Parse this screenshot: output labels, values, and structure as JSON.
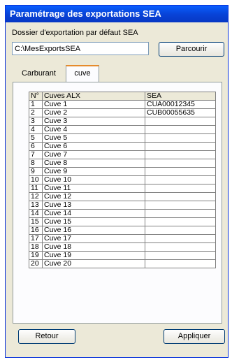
{
  "window": {
    "title": "Paramétrage des exportations SEA"
  },
  "export": {
    "folder_label": "Dossier d'exportation par défaut SEA",
    "folder_value": "C:\\MesExportsSEA",
    "browse_label": "Parcourir"
  },
  "tabs": [
    {
      "label": "Carburant",
      "active": false
    },
    {
      "label": "cuve",
      "active": true
    }
  ],
  "grid": {
    "columns": [
      "N°",
      "Cuves ALX",
      "SEA"
    ],
    "rows": [
      [
        "1",
        "Cuve 1",
        "CUA00012345"
      ],
      [
        "2",
        "Cuve 2",
        "CUB00055635"
      ],
      [
        "3",
        "Cuve 3",
        ""
      ],
      [
        "4",
        "Cuve 4",
        ""
      ],
      [
        "5",
        "Cuve 5",
        ""
      ],
      [
        "6",
        "Cuve 6",
        ""
      ],
      [
        "7",
        "Cuve 7",
        ""
      ],
      [
        "8",
        "Cuve 8",
        ""
      ],
      [
        "9",
        "Cuve 9",
        ""
      ],
      [
        "10",
        "Cuve 10",
        ""
      ],
      [
        "11",
        "Cuve 11",
        ""
      ],
      [
        "12",
        "Cuve 12",
        ""
      ],
      [
        "13",
        "Cuve 13",
        ""
      ],
      [
        "14",
        "Cuve 14",
        ""
      ],
      [
        "15",
        "Cuve 15",
        ""
      ],
      [
        "16",
        "Cuve 16",
        ""
      ],
      [
        "17",
        "Cuve 17",
        ""
      ],
      [
        "18",
        "Cuve 18",
        ""
      ],
      [
        "19",
        "Cuve 19",
        ""
      ],
      [
        "20",
        "Cuve 20",
        ""
      ]
    ]
  },
  "footer": {
    "back_label": "Retour",
    "apply_label": "Appliquer"
  }
}
